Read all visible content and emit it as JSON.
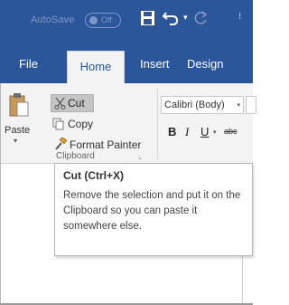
{
  "titlebar": {
    "autosave_label": "AutoSave",
    "autosave_state": "Off",
    "icons": [
      "save-icon",
      "undo-icon",
      "redo-icon",
      "more-icon"
    ],
    "undo_dropdown": "▾",
    "more": "⁝"
  },
  "tabs": [
    {
      "label": "File"
    },
    {
      "label": "Home"
    },
    {
      "label": "Insert"
    },
    {
      "label": "Design"
    }
  ],
  "clipboard": {
    "paste_label": "Paste",
    "paste_arrow": "▾",
    "cut_label": "Cut",
    "copy_label": "Copy",
    "format_painter_label": "Format Painter",
    "group_label": "Clipboard",
    "launcher": "⌞"
  },
  "font": {
    "font_name": "Calibri (Body)",
    "font_arrow": "▾",
    "bold": "B",
    "italic": "I",
    "underline": "U",
    "underline_drop": "▾",
    "strikethrough": "abc"
  },
  "tooltip": {
    "title": "Cut (Ctrl+X)",
    "description": "Remove the selection and put it on the Clipboard so you can paste it somewhere else."
  },
  "colors": {
    "ribbon_blue": "#2b579a",
    "ribbon_bg": "#f3f3f3",
    "highlight": "#c5c5c5"
  }
}
